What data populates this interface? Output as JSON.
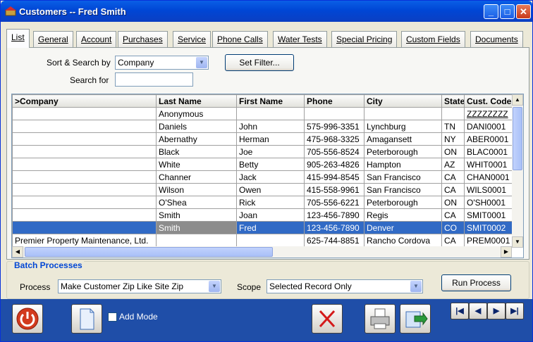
{
  "window": {
    "title": "Customers -- Fred Smith"
  },
  "tabs": [
    {
      "label": "List"
    },
    {
      "label": "General"
    },
    {
      "label": "Account"
    },
    {
      "label": "Purchases"
    },
    {
      "label": "Service"
    },
    {
      "label": "Phone Calls"
    },
    {
      "label": "Water Tests"
    },
    {
      "label": "Special Pricing"
    },
    {
      "label": "Custom Fields"
    },
    {
      "label": "Documents"
    }
  ],
  "search": {
    "sort_label": "Sort & Search by",
    "sort_value": "Company",
    "search_label": "Search for",
    "search_value": "",
    "filter_button": "Set Filter..."
  },
  "grid": {
    "columns": [
      ">Company",
      "Last Name",
      "First Name",
      "Phone",
      "City",
      "State",
      "Cust. Code"
    ],
    "rows": [
      [
        "",
        "Anonymous",
        "",
        "",
        "",
        "",
        "ZZZZZZZZ"
      ],
      [
        "",
        "Daniels",
        "John",
        "575-996-3351",
        "Lynchburg",
        "TN",
        "DANI0001"
      ],
      [
        "",
        "Abernathy",
        "Herman",
        "475-968-3325",
        "Amagansett",
        "NY",
        "ABER0001"
      ],
      [
        "",
        "Black",
        "Joe",
        "705-556-8524",
        "Peterborough",
        "ON",
        "BLAC0001"
      ],
      [
        "",
        "White",
        "Betty",
        "905-263-4826",
        "Hampton",
        "AZ",
        "WHIT0001"
      ],
      [
        "",
        "Channer",
        "Jack",
        "415-994-8545",
        "San Francisco",
        "CA",
        "CHAN0001"
      ],
      [
        "",
        "Wilson",
        "Owen",
        "415-558-9961",
        "San Francisco",
        "CA",
        "WILS0001"
      ],
      [
        "",
        "O'Shea",
        "Rick",
        "705-556-6221",
        "Peterborough",
        "ON",
        "O'SH0001"
      ],
      [
        "",
        "Smith",
        "Joan",
        "123-456-7890",
        "Regis",
        "CA",
        "SMIT0001"
      ],
      [
        "",
        "Smith",
        "Fred",
        "123-456-7890",
        "Denver",
        "CO",
        "SMIT0002"
      ],
      [
        "Premier Property Maintenance, Ltd.",
        "",
        "",
        "625-744-8851",
        "Rancho Cordova",
        "CA",
        "PREM0001"
      ]
    ],
    "selected_row": 9
  },
  "batch": {
    "caption": "Batch Processes",
    "process_label": "Process",
    "process_value": "Make Customer Zip Like Site Zip",
    "scope_label": "Scope",
    "scope_value": "Selected Record Only",
    "run_button": "Run Process"
  },
  "footer": {
    "add_mode_label": "Add Mode",
    "icons": [
      "power-icon",
      "new-document-icon",
      "delete-x-icon",
      "print-icon",
      "export-icon"
    ],
    "nav_icons": [
      "first-record-icon",
      "previous-record-icon",
      "next-record-icon",
      "last-record-icon"
    ]
  },
  "colors": {
    "titlebar": "#0046d5",
    "selection": "#316ac5",
    "footer": "#1f4ea8",
    "batch_caption": "#0046d5"
  }
}
